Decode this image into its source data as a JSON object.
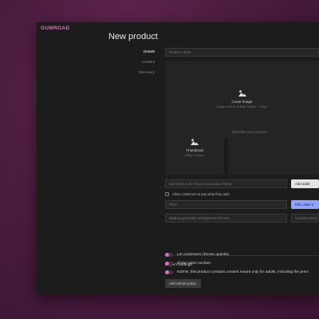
{
  "brand": {
    "logo": "GUMROAD"
  },
  "page": {
    "title": "New product"
  },
  "nav": {
    "items": [
      "Details",
      "Content",
      "Discovery"
    ],
    "active": "Details"
  },
  "form": {
    "name_placeholder": "Product name",
    "cover": {
      "title": "Cover image",
      "hint": "Image must be at least 1280px × 720px"
    },
    "thumbnail": {
      "title": "Thumbnail",
      "hint": "600px × 600px"
    },
    "description_placeholder": "Describe your product...",
    "summary_placeholder": "Summary to be shown on product listing",
    "add_button": "Add addit",
    "pay_what_they_want": "Allow customers to pay what they wish.",
    "price_placeholder": "Price",
    "edit_label_button": "Edit Label o",
    "url_placeholder": "delancy.gumroad.com/optimize-for-seo",
    "custom_domain_placeholder": "Custom doma"
  },
  "buyer_settings": {
    "title": "Buyer's settings",
    "options": [
      "Let customers choose quantity",
      "Show sales number",
      "NSFW, this product contains content meant only for adults, including the previ"
    ],
    "refund_button": "Add refund policy"
  },
  "colors": {
    "accent": "#d86fb7",
    "button_accent": "#8fa3ff",
    "background": "#1c1c1c"
  }
}
